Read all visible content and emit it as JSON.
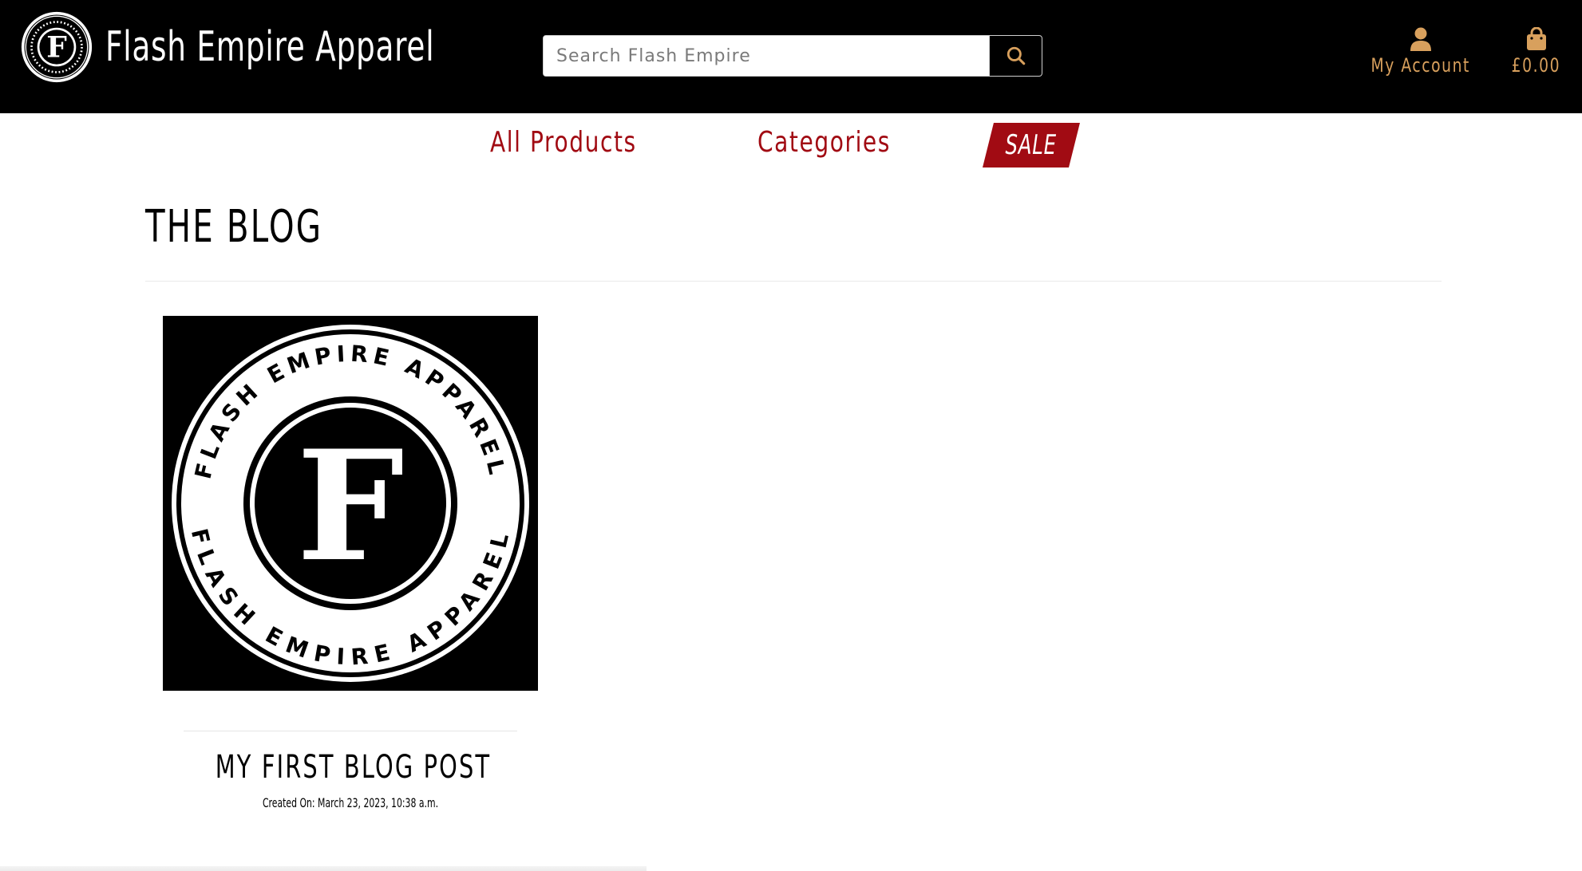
{
  "header": {
    "brand_name": "Flash Empire Apparel",
    "logo_icon": "flash-empire-seal-logo",
    "search": {
      "placeholder": "Search Flash Empire",
      "value": "",
      "button_icon": "search-icon"
    },
    "account": {
      "icon": "user-icon",
      "label": "My Account"
    },
    "bag": {
      "icon": "shopping-bag-icon",
      "total": "£0.00"
    }
  },
  "nav": {
    "items": [
      {
        "label": "All Products"
      },
      {
        "label": "Categories"
      },
      {
        "label": "SALE"
      }
    ]
  },
  "blog": {
    "title": "THE BLOG",
    "posts": [
      {
        "image_icon": "flash-empire-apparel-logo",
        "image_text": "FLASH EMPIRE APPAREL",
        "image_letter": "F",
        "title": "MY FIRST BLOG POST",
        "meta": "Created On: March 23, 2023, 10:38 a.m."
      }
    ]
  },
  "colors": {
    "header_bg": "#000000",
    "accent_gold": "#d8a05d",
    "brand_red": "#a10b13",
    "text": "#000000"
  }
}
